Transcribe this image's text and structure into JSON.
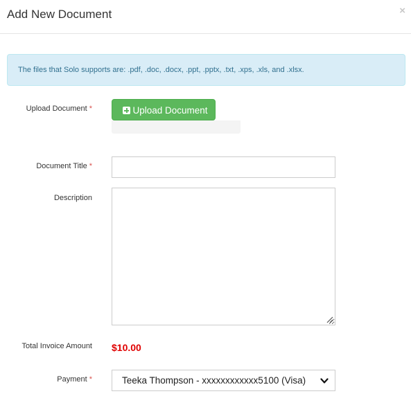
{
  "modal": {
    "title": "Add New Document",
    "close_glyph": "×"
  },
  "alert": {
    "text": "The files that Solo supports are: .pdf, .doc, .docx, .ppt, .pptx, .txt, .xps, .xls, and .xlsx."
  },
  "form": {
    "required_mark": "*",
    "upload": {
      "label": "Upload Document",
      "button_label": "Upload Document",
      "button_icon": "plus-square-icon",
      "button_color": "#5cb85c"
    },
    "document_title": {
      "label": "Document Title",
      "value": ""
    },
    "description": {
      "label": "Description",
      "value": ""
    },
    "total_invoice": {
      "label": "Total Invoice Amount",
      "amount": "$10.00",
      "amount_color": "#e00000"
    },
    "payment": {
      "label": "Payment",
      "selected": "Teeka Thompson - xxxxxxxxxxxx5100 (Visa)",
      "icon": "chevron-down-icon"
    }
  },
  "colors": {
    "alert_bg": "#d9edf7",
    "alert_text": "#31708f",
    "required": "#d9534f"
  }
}
